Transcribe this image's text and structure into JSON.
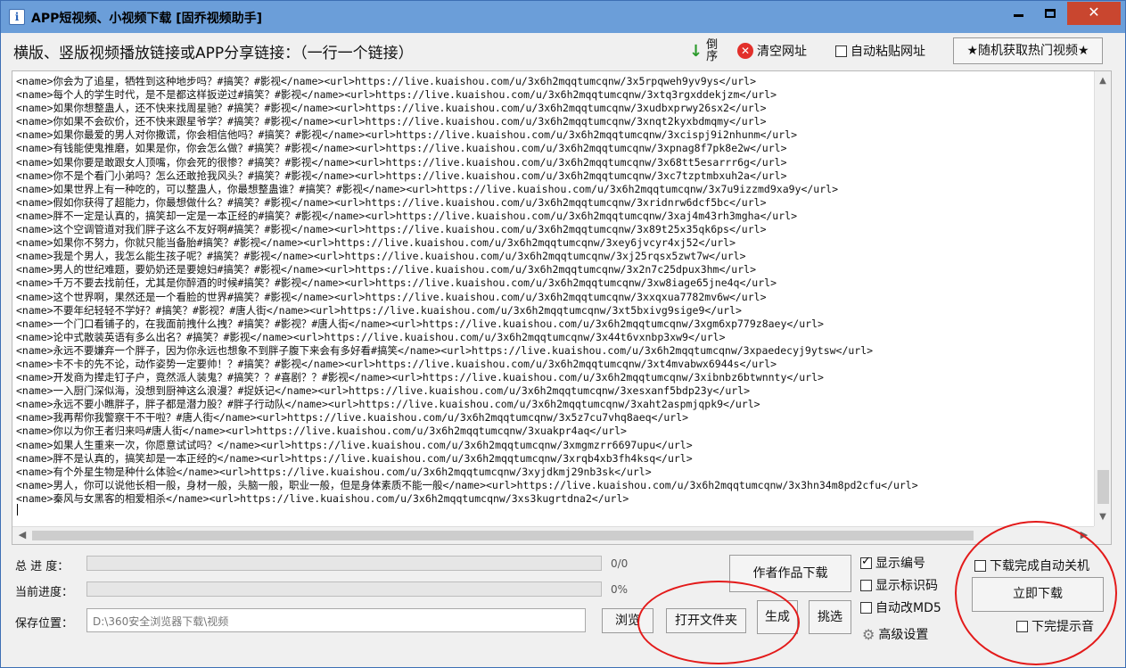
{
  "window": {
    "title": "APP短视频、小视频下载 [固乔视频助手]",
    "icon_letter": "i",
    "minimize_icon": "minimize-icon",
    "maximize_icon": "maximize-icon",
    "close_icon": "close-icon",
    "close_glyph": "✕"
  },
  "header": {
    "hint": "横版、竖版视频播放链接或APP分享链接：（一行一个链接）",
    "sort_label": "倒序",
    "sort_icon": "↓",
    "clear_label": "清空网址",
    "clear_icon": "✕",
    "autopaste_label": "自动粘贴网址",
    "autopaste_checked": false,
    "hot_button": "★随机获取热门视频★"
  },
  "editor": {
    "lines": [
      "<name>你会为了追星，牺牲到这种地步吗？#搞笑？#影视</name><url>https://live.kuaishou.com/u/3x6h2mqqtumcqnw/3x5rpqweh9yv9ys</url>",
      "<name>每个人的学生时代，是不是都这样扳逆过#搞笑？#影视</name><url>https://live.kuaishou.com/u/3x6h2mqqtumcqnw/3xtq3rgxddekjzm</url>",
      "<name>如果你想整蛊人，还不快来找周星驰？#搞笑？#影视</name><url>https://live.kuaishou.com/u/3x6h2mqqtumcqnw/3xudbxprwy26sx2</url>",
      "<name>你如果不会砍价，还不快来跟星爷学？#搞笑？#影视</name><url>https://live.kuaishou.com/u/3x6h2mqqtumcqnw/3xnqt2kyxbdmqmy</url>",
      "<name>如果你最爱的男人对你撒谎，你会相信他吗？#搞笑？#影视</name><url>https://live.kuaishou.com/u/3x6h2mqqtumcqnw/3xcispj9i2nhunm</url>",
      "<name>有钱能使鬼推磨，如果是你，你会怎么做？#搞笑？#影视</name><url>https://live.kuaishou.com/u/3x6h2mqqtumcqnw/3xpnag8f7pk8e2w</url>",
      "<name>如果你要是敢跟女人顶嘴，你会死的很惨？#搞笑？#影视</name><url>https://live.kuaishou.com/u/3x6h2mqqtumcqnw/3x68tt5esarrr6g</url>",
      "<name>你不是个看门小弟吗？怎么还敢抢我风头？#搞笑？#影视</name><url>https://live.kuaishou.com/u/3x6h2mqqtumcqnw/3xc7tzptmbxuh2a</url>",
      "<name>如果世界上有一种吃的，可以整蛊人，你最想整蛊谁？#搞笑？#影视</name><url>https://live.kuaishou.com/u/3x6h2mqqtumcqnw/3x7u9izzmd9xa9y</url>",
      "<name>假如你获得了超能力，你最想做什么？#搞笑？#影视</name><url>https://live.kuaishou.com/u/3x6h2mqqtumcqnw/3xridnrw6dcf5bc</url>",
      "<name>胖不一定是认真的，搞笑却一定是一本正经的#搞笑？#影视</name><url>https://live.kuaishou.com/u/3x6h2mqqtumcqnw/3xaj4m43rh3mgha</url>",
      "<name>这个空调管道对我们胖子这么不友好啊#搞笑？#影视</name><url>https://live.kuaishou.com/u/3x6h2mqqtumcqnw/3x89t25x35qk6ps</url>",
      "<name>如果你不努力，你就只能当备胎#搞笑？#影视</name><url>https://live.kuaishou.com/u/3x6h2mqqtumcqnw/3xey6jvcyr4xj52</url>",
      "<name>我是个男人，我怎么能生孩子呢？#搞笑？#影视</name><url>https://live.kuaishou.com/u/3x6h2mqqtumcqnw/3xj25rqsx5zwt7w</url>",
      "<name>男人的世纪难题，要奶奶还是要媳妇#搞笑？#影视</name><url>https://live.kuaishou.com/u/3x6h2mqqtumcqnw/3x2n7c25dpux3hm</url>",
      "<name>千万不要去找前任，尤其是你醉酒的时候#搞笑？#影视</name><url>https://live.kuaishou.com/u/3x6h2mqqtumcqnw/3xw8iage65jne4q</url>",
      "<name>这个世界啊，果然还是一个看脸的世界#搞笑？#影视</name><url>https://live.kuaishou.com/u/3x6h2mqqtumcqnw/3xxqxua7782mv6w</url>",
      "<name>不要年纪轻轻不学好？#搞笑？#影视？#唐人街</name><url>https://live.kuaishou.com/u/3x6h2mqqtumcqnw/3xt5bxivg9sige9</url>",
      "<name>一个门口看铺子的，在我面前拽什么拽？#搞笑？#影视？#唐人街</name><url>https://live.kuaishou.com/u/3x6h2mqqtumcqnw/3xgm6xp779z8aey</url>",
      "<name>论中式散装英语有多么出名？#搞笑？#影视</name><url>https://live.kuaishou.com/u/3x6h2mqqtumcqnw/3x44t6vxnbp3xw9</url>",
      "<name>永远不要嫌弃一个胖子，因为你永远也想象不到胖子腹下来会有多好看#搞笑</name><url>https://live.kuaishou.com/u/3x6h2mqqtumcqnw/3xpaedecyj9ytsw</url>",
      "<name>卡不卡的先不论，动作姿势一定要帅！？#搞笑？#影视</name><url>https://live.kuaishou.com/u/3x6h2mqqtumcqnw/3xt4mvabwx6944s</url>",
      "<name>开发商为撵走钉子户，竟然派人装鬼？#搞笑？？#喜剧？？#影视</name><url>https://live.kuaishou.com/u/3x6h2mqqtumcqnw/3xibnbz6btwnnty</url>",
      "<name>一入厨门深似海，没想到厨神这么浪漫？#捉妖记</name><url>https://live.kuaishou.com/u/3x6h2mqqtumcqnw/3xesxanf5bdp23y</url>",
      "<name>永远不要小瞧胖子，胖子都是潜力股？#胖子行动队</name><url>https://live.kuaishou.com/u/3x6h2mqqtumcqnw/3xaht2aspmjqpk9</url>",
      "<name>我再帮你我警察干不干啦？#唐人街</name><url>https://live.kuaishou.com/u/3x6h2mqqtumcqnw/3x5z7cu7vhq8aeq</url>",
      "<name>你以为你王者归来吗#唐人街</name><url>https://live.kuaishou.com/u/3x6h2mqqtumcqnw/3xuakpr4aq</url>",
      "<name>如果人生重来一次，你愿意试试吗？</name><url>https://live.kuaishou.com/u/3x6h2mqqtumcqnw/3xmgmzrr6697upu</url>",
      "<name>胖不是认真的，搞笑却是一本正经的</name><url>https://live.kuaishou.com/u/3x6h2mqqtumcqnw/3xrqb4xb3fh4ksq</url>",
      "<name>有个外星生物是种什么体验</name><url>https://live.kuaishou.com/u/3x6h2mqqtumcqnw/3xyjdkmj29nb3sk</url>",
      "<name>男人，你可以说他长相一般，身材一般，头脑一般，职业一般，但是身体素质不能一般</name><url>https://live.kuaishou.com/u/3x6h2mqqtumcqnw/3x3hn34m8pd2cfu</url>",
      "<name>秦风与女黑客的相爱相杀</name><url>https://live.kuaishou.com/u/3x6h2mqqtumcqnw/3xs3kugrtdna2</url>"
    ]
  },
  "progress": {
    "total_label": "总 进 度：",
    "total_value": "0/0",
    "total_fraction": 0,
    "current_label": "当前进度：",
    "current_value": "0%",
    "current_fraction": 0
  },
  "save": {
    "label": "保存位置：",
    "path": "D:\\360安全浏览器下载\\视频"
  },
  "buttons": {
    "browse": "浏览",
    "open_folder": "打开文件夹",
    "generate": "生成",
    "pick": "挑选",
    "author_download": "作者作品下载",
    "start_download": "立即下载"
  },
  "options": {
    "show_number": {
      "label": "显示编号",
      "checked": true
    },
    "show_identifier": {
      "label": "显示标识码",
      "checked": false
    },
    "auto_md5": {
      "label": "自动改MD5",
      "checked": false
    },
    "advanced": "高级设置",
    "shutdown_after": {
      "label": "下载完成自动关机",
      "checked": false
    },
    "notify_done": {
      "label": "下完提示音",
      "checked": false
    }
  },
  "colors": {
    "titlebar": "#6b9ed9",
    "close_button": "#c9462f",
    "annotation_circle": "#e31a1a",
    "progress_fill": "#06b025"
  }
}
